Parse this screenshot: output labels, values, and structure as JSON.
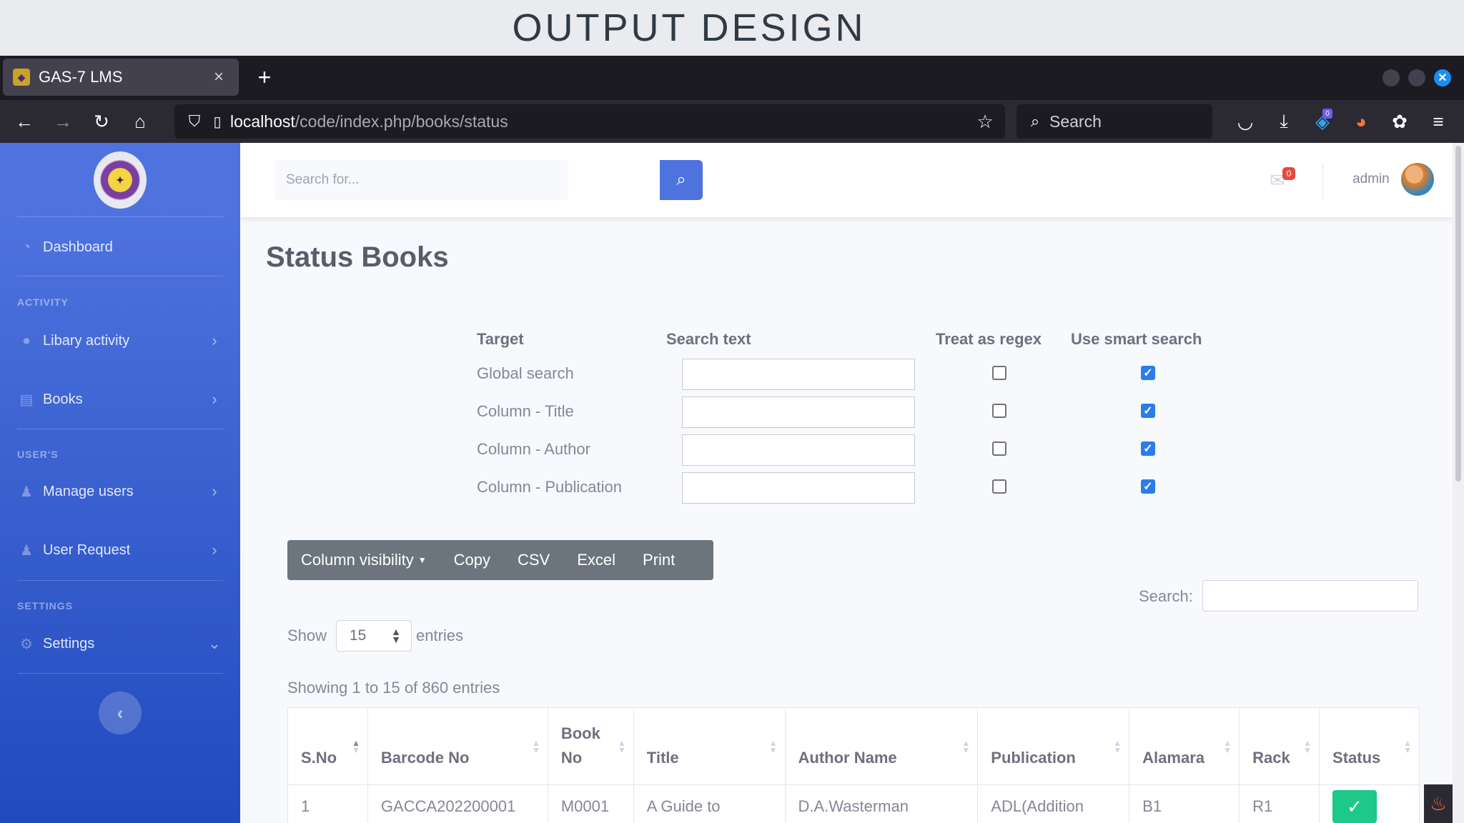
{
  "banner": {
    "title": "OUTPUT DESIGN"
  },
  "browser": {
    "tab_title": "GAS-7 LMS",
    "tab_close": "×",
    "new_tab": "+",
    "url_host": "localhost",
    "url_path": "/code/index.php/books/status",
    "search_placeholder": "Search",
    "extension_badge": "0"
  },
  "sidebar": {
    "dashboard": "Dashboard",
    "heading_activity": "ACTIVITY",
    "library_activity": "Libary activity",
    "books": "Books",
    "heading_users": "USER'S",
    "manage_users": "Manage users",
    "user_request": "User Request",
    "heading_settings": "SETTINGS",
    "settings": "Settings"
  },
  "topbar": {
    "search_placeholder": "Search for...",
    "mail_count": "0",
    "user_name": "admin"
  },
  "page": {
    "title": "Status Books"
  },
  "search_builder": {
    "headers": {
      "target": "Target",
      "search_text": "Search text",
      "regex": "Treat as regex",
      "smart": "Use smart search"
    },
    "rows": [
      {
        "label": "Global search",
        "regex": false,
        "smart": true
      },
      {
        "label": "Column - Title",
        "regex": false,
        "smart": true
      },
      {
        "label": "Column - Author",
        "regex": false,
        "smart": true
      },
      {
        "label": "Column - Publication",
        "regex": false,
        "smart": true
      }
    ]
  },
  "buttons": {
    "column_visibility": "Column visibility",
    "copy": "Copy",
    "csv": "CSV",
    "excel": "Excel",
    "print": "Print"
  },
  "datatable": {
    "search_label": "Search:",
    "show_label": "Show",
    "page_length": "15",
    "entries_label": "entries",
    "info": "Showing 1 to 15 of 860 entries",
    "columns": [
      "S.No",
      "Barcode No",
      "Book No",
      "Title",
      "Author Name",
      "Publication",
      "Alamara",
      "Rack",
      "Status"
    ],
    "rows": [
      {
        "sno": "1",
        "barcode": "GACCA202200001",
        "book_no": "M0001",
        "title": "A Guide to",
        "author": "D.A.Wasterman",
        "publication": "ADL(Addition",
        "alamara": "B1",
        "rack": "R1",
        "status": "✓"
      }
    ]
  },
  "colors": {
    "primary": "#4e73df",
    "success": "#1cc88a",
    "secondary_btn": "#6c757d",
    "danger_badge": "#e74a3b"
  }
}
